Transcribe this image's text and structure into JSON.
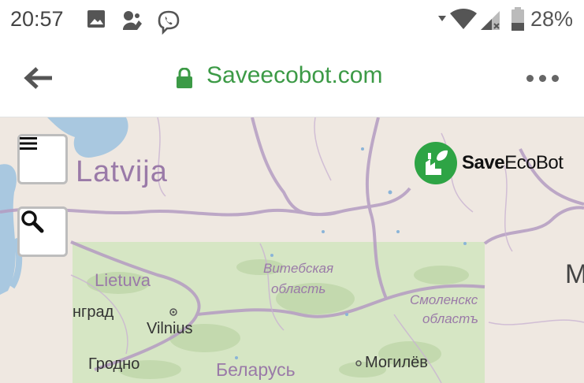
{
  "status_bar": {
    "time": "20:57",
    "battery": "28%",
    "icons": [
      "image-icon",
      "app-icon",
      "viber-icon",
      "wifi-icon",
      "signal-icon",
      "battery-icon"
    ]
  },
  "browser": {
    "domain": "Saveecobot.com",
    "secure": true,
    "accent": "#3c9a46"
  },
  "map": {
    "brand": {
      "strong": "Save",
      "light": "EcoBot"
    },
    "labels": {
      "latvija": "Latvija",
      "lietuva": "Lietuva",
      "vitebsk1": "Витебская",
      "vitebsk2": "область",
      "smolensk1": "Смоленскс",
      "smolensk2": "областъ",
      "ngrad": "нград",
      "vilnius": "Vilnius",
      "grodno": "Гродно",
      "belarus": "Беларусь",
      "mogilev": "Могилёв",
      "edge_m": "M"
    },
    "controls": [
      "menu-icon",
      "search-icon"
    ]
  }
}
